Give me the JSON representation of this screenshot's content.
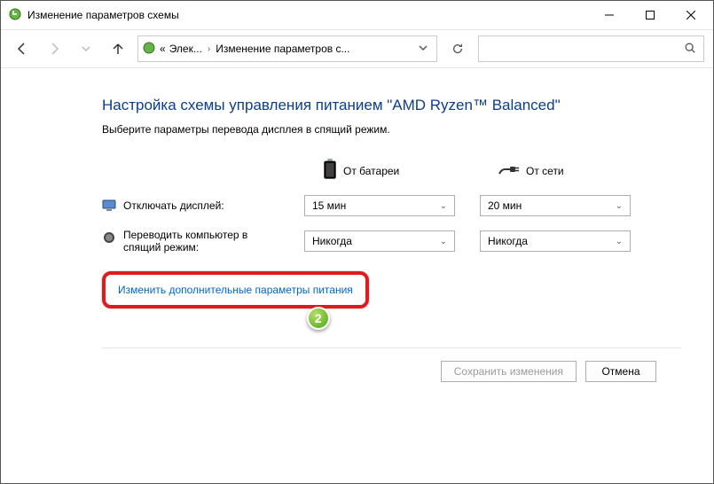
{
  "window": {
    "title": "Изменение параметров схемы"
  },
  "breadcrumbs": {
    "prefix": "«",
    "seg1": "Элек...",
    "seg2": "Изменение параметров с..."
  },
  "search": {
    "placeholder": ""
  },
  "page": {
    "heading": "Настройка схемы управления питанием \"AMD Ryzen™ Balanced\"",
    "sub": "Выберите параметры перевода дисплея в спящий режим."
  },
  "cols": {
    "battery": "От батареи",
    "ac": "От сети"
  },
  "rows": {
    "display_off": "Отключать дисплей:",
    "sleep": "Переводить компьютер в спящий режим:"
  },
  "values": {
    "display_off_battery": "15 мин",
    "display_off_ac": "20 мин",
    "sleep_battery": "Никогда",
    "sleep_ac": "Никогда"
  },
  "link": "Изменить дополнительные параметры питания",
  "badge": "2",
  "buttons": {
    "save": "Сохранить изменения",
    "cancel": "Отмена"
  }
}
